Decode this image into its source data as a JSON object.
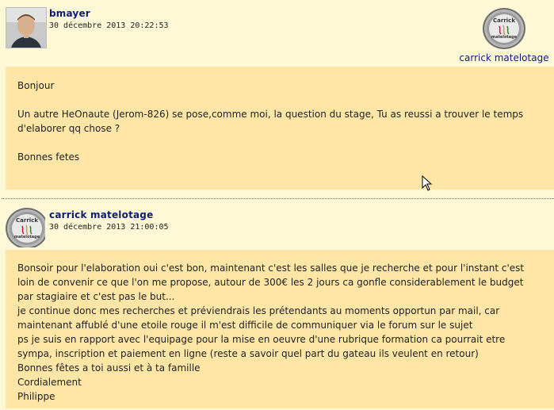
{
  "posts": [
    {
      "author": "bmayer",
      "date": "30 décembre 2013 20:22:53",
      "badge_caption": "carrick matelotage",
      "logo": {
        "top": "Carrick",
        "bottom": "matelotage"
      },
      "paragraphs": [
        "Bonjour",
        "",
        "Un autre HeOnaute (Jerom-826) se pose,comme moi, la question du stage, Tu as reussi a trouver le temps",
        "d'elaborer qq chose ?",
        "",
        "Bonnes fetes"
      ]
    },
    {
      "author": "carrick matelotage",
      "date": "30 décembre 2013 21:00:05",
      "logo": {
        "top": "Carrick",
        "bottom": "matelotage"
      },
      "paragraphs": [
        "Bonsoir pour l'elaboration oui c'est bon, maintenant c'est les salles que je recherche et pour l'instant c'est",
        "loin de convenir ce que l'on me propose, autour de 300€ les 2 jours ca gonfle considerablement le budget",
        "par stagiaire et c'est pas le but...",
        "je continue donc mes recherches et préviendrais les prétendants au moments opportun par mail, car",
        "maintenant affublé d'une etoile rouge il m'est difficile de communiquer via le forum sur le sujet",
        "ps je suis en rapport avec l'equipage pour la mise en oeuvre d'une rubrique formation ca pourrait etre",
        "sympa, inscription et paiement en ligne (reste a savoir quel part du gateau ils veulent en retour)",
        "Bonnes fêtes a toi aussi et à ta famille",
        "Cordialement",
        "Philippe"
      ]
    }
  ]
}
